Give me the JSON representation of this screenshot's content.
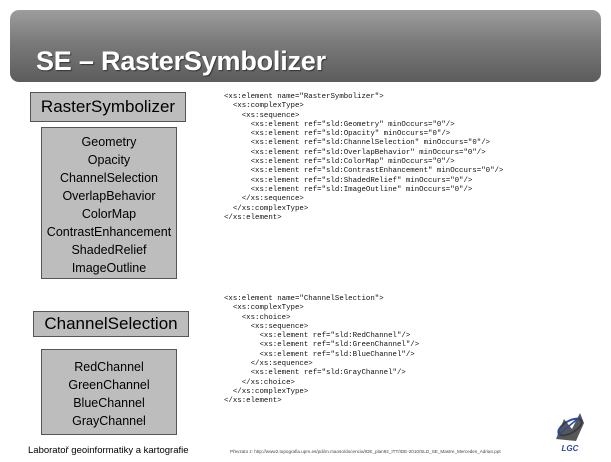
{
  "title": "SE – RasterSymbolizer",
  "raster_box": {
    "header": "RasterSymbolizer",
    "items": [
      "Geometry",
      "Opacity",
      "ChannelSelection",
      "OverlapBehavior",
      "ColorMap",
      "ContrastEnhancement",
      "ShadedRelief",
      "ImageOutline"
    ]
  },
  "channel_box": {
    "header": "ChannelSelection",
    "items": [
      "RedChannel",
      "GreenChannel",
      "BlueChannel",
      "GrayChannel"
    ]
  },
  "code_raster": [
    "<xs:element name=\"RasterSymbolizer\">",
    "  <xs:complexType>",
    "    <xs:sequence>",
    "      <xs:element ref=\"sld:Geometry\" minOccurs=\"0\"/>",
    "      <xs:element ref=\"sld:Opacity\" minOccurs=\"0\"/>",
    "      <xs:element ref=\"sld:ChannelSelection\" minOccurs=\"0\"/>",
    "      <xs:element ref=\"sld:OverlapBehavior\" minOccurs=\"0\"/>",
    "      <xs:element ref=\"sld:ColorMap\" minOccurs=\"0\"/>",
    "      <xs:element ref=\"sld:ContrastEnhancement\" minOccurs=\"0\"/>",
    "      <xs:element ref=\"sld:ShadedRelief\" minOccurs=\"0\"/>",
    "      <xs:element ref=\"sld:ImageOutline\" minOccurs=\"0\"/>",
    "    </xs:sequence>",
    "  </xs:complexType>",
    "</xs:element>"
  ],
  "code_channel": [
    "<xs:element name=\"ChannelSelection\">",
    "  <xs:complexType>",
    "    <xs:choice>",
    "      <xs:sequence>",
    "        <xs:element ref=\"sld:RedChannel\"/>",
    "        <xs:element ref=\"sld:GreenChannel\"/>",
    "        <xs:element ref=\"sld:BlueChannel\"/>",
    "      </xs:sequence>",
    "      <xs:element ref=\"sld:GrayChannel\"/>",
    "    </xs:choice>",
    "  </xs:complexType>",
    "</xs:element>"
  ],
  "footer_left": "Laboratoř geoinformatiky a kartografie",
  "footer_right": "Převzato z: http://www2.topografia.upm.es/pdi/m.manso/docencia/IDE_plan92_ITT/IDE-2010/SLD_SE_Mastre_Mercedes_Adrian.ppt",
  "logo_text": "LGC",
  "colors": {
    "banner": "#7a7a7a",
    "box_fill": "#bdbdbd",
    "logo_blue": "#2b4aa0"
  }
}
